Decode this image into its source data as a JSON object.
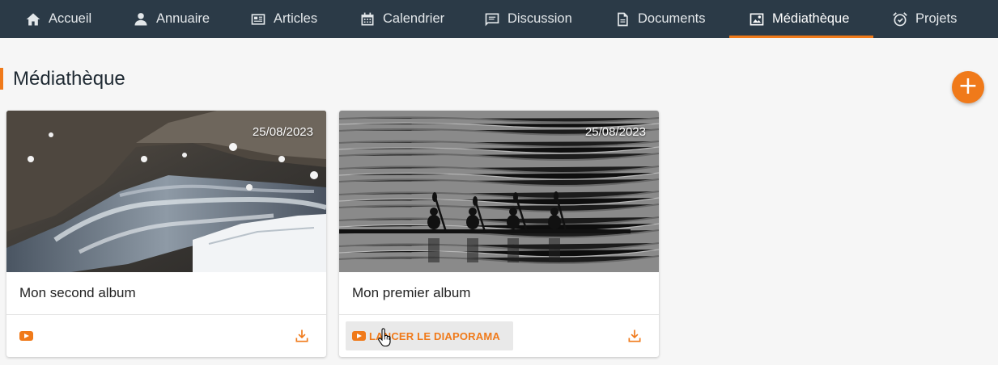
{
  "nav": {
    "items": [
      {
        "label": "Accueil",
        "icon": "home-icon"
      },
      {
        "label": "Annuaire",
        "icon": "person-icon"
      },
      {
        "label": "Articles",
        "icon": "article-icon"
      },
      {
        "label": "Calendrier",
        "icon": "calendar-icon"
      },
      {
        "label": "Discussion",
        "icon": "chat-icon"
      },
      {
        "label": "Documents",
        "icon": "document-icon"
      },
      {
        "label": "Médiathèque",
        "icon": "image-icon",
        "active": true
      },
      {
        "label": "Projets",
        "icon": "alarm-check-icon"
      }
    ],
    "accent": "#f07a1a",
    "background": "#2b3a47"
  },
  "page": {
    "title": "Médiathèque",
    "add_button": "+"
  },
  "albums": [
    {
      "title": "Mon second album",
      "date": "25/08/2023",
      "image": "river-with-snow"
    },
    {
      "title": "Mon premier album",
      "date": "25/08/2023",
      "image": "kayakers-silhouette",
      "play_label": "LANCER LE DIAPORAMA"
    }
  ]
}
